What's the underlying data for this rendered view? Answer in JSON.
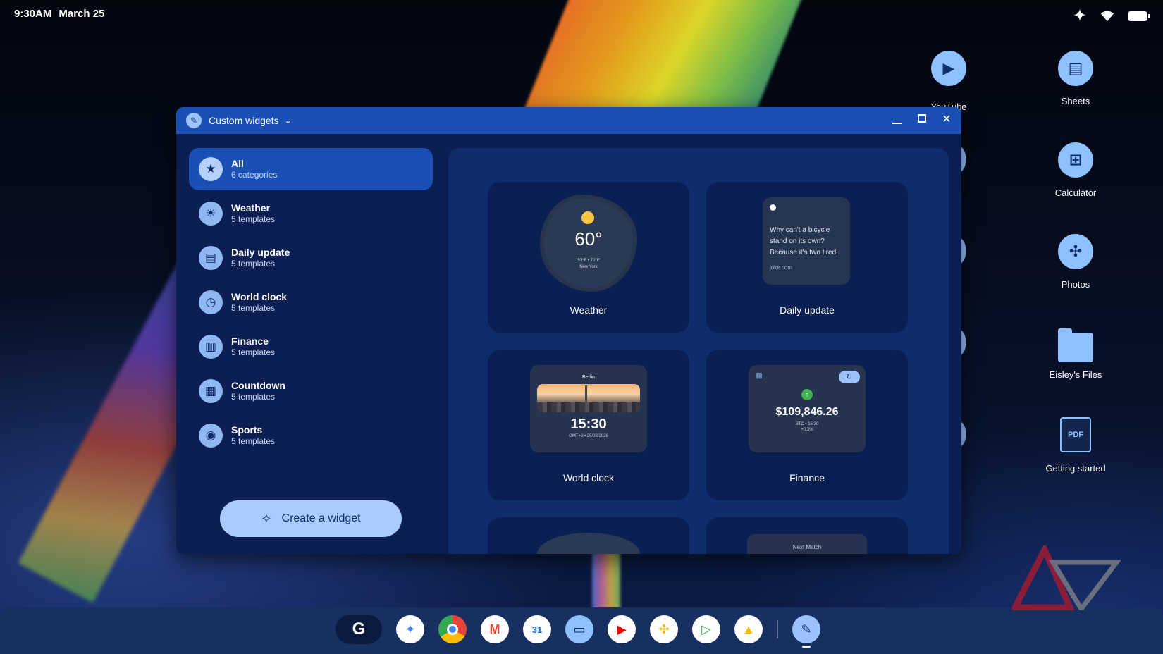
{
  "status_bar": {
    "time": "9:30AM",
    "date": "March 25"
  },
  "desktop_icons": [
    {
      "label": "YouTube"
    },
    {
      "label": "Sheets"
    },
    {
      "label": "Calculator"
    },
    {
      "label": "Photos"
    },
    {
      "label": "Eisley's Files"
    },
    {
      "label": "Getting started",
      "badge": "PDF"
    }
  ],
  "window": {
    "title": "Custom widgets",
    "sidebar": {
      "items": [
        {
          "name": "All",
          "sub": "6 categories",
          "icon": "star-icon"
        },
        {
          "name": "Weather",
          "sub": "5 templates",
          "icon": "weather-icon"
        },
        {
          "name": "Daily update",
          "sub": "5 templates",
          "icon": "news-icon"
        },
        {
          "name": "World clock",
          "sub": "5 templates",
          "icon": "clock-icon"
        },
        {
          "name": "Finance",
          "sub": "5 templates",
          "icon": "bar-chart-icon"
        },
        {
          "name": "Countdown",
          "sub": "5 templates",
          "icon": "calendar-icon"
        },
        {
          "name": "Sports",
          "sub": "5 templates",
          "icon": "whistle-icon"
        }
      ],
      "create_button": "Create a widget"
    },
    "cards": {
      "weather": {
        "label": "Weather",
        "temp": "60°",
        "range": "53°F • 70°F",
        "city": "New York"
      },
      "daily": {
        "label": "Daily update",
        "joke": "Why can't a bicycle stand on its own? Because it's two tired!",
        "source": "joke.com"
      },
      "clock": {
        "label": "World clock",
        "city": "Berlin",
        "time": "15:30",
        "sub": "GMT+2 • 25/03/2026"
      },
      "finance": {
        "label": "Finance",
        "value": "$109,846.26",
        "sub1": "BTC • 15:30",
        "sub2": "+0.3%"
      },
      "next_peek": "Next Match"
    }
  },
  "colors": {
    "accent": "#1a4fb4",
    "window_bg": "#0b1f52",
    "button": "#a9cbff"
  }
}
